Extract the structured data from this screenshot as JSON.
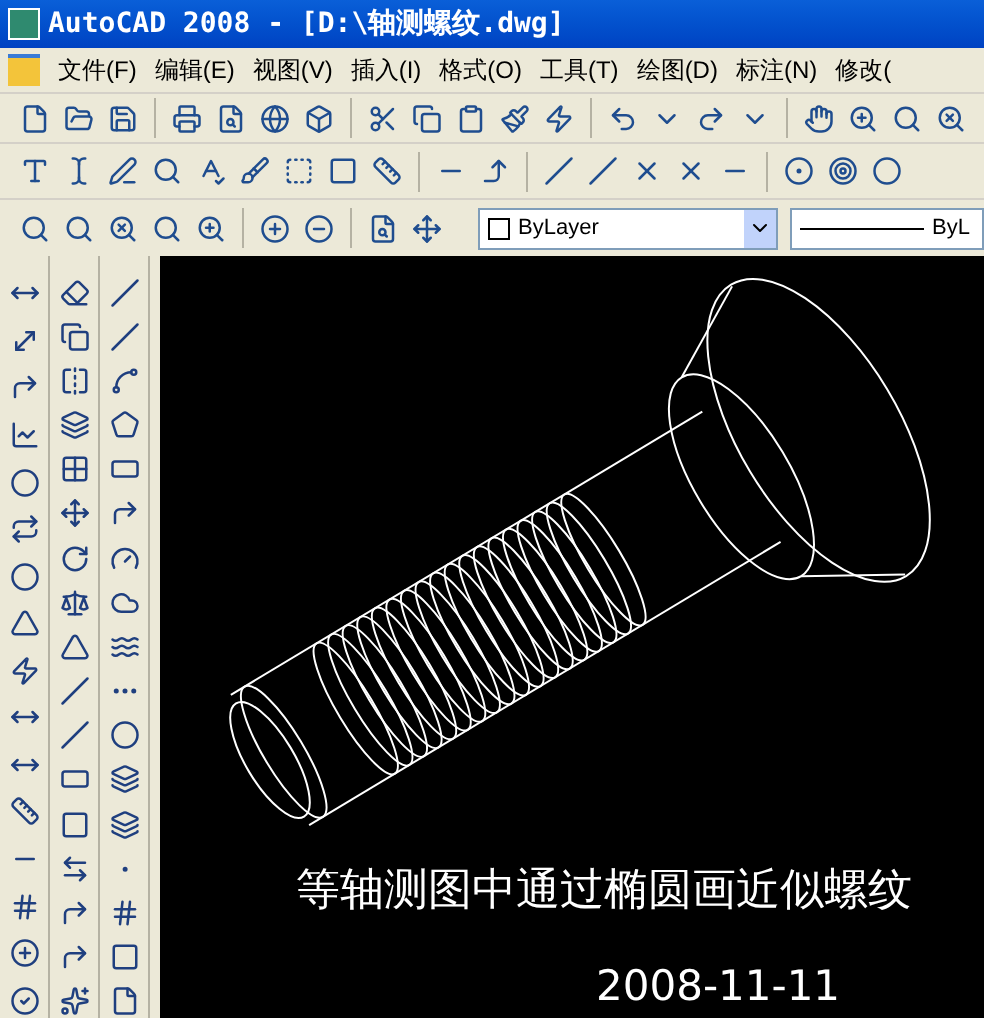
{
  "window": {
    "title": "AutoCAD 2008 - [D:\\轴测螺纹.dwg]"
  },
  "menu": [
    "文件(F)",
    "编辑(E)",
    "视图(V)",
    "插入(I)",
    "格式(O)",
    "工具(T)",
    "绘图(D)",
    "标注(N)",
    "修改("
  ],
  "layer_dropdown": {
    "value": "ByLayer"
  },
  "linetype_dropdown": {
    "value": "ByL"
  },
  "canvas": {
    "caption": "等轴测图中通过椭圆画近似螺纹",
    "date": "2008-11-11"
  }
}
